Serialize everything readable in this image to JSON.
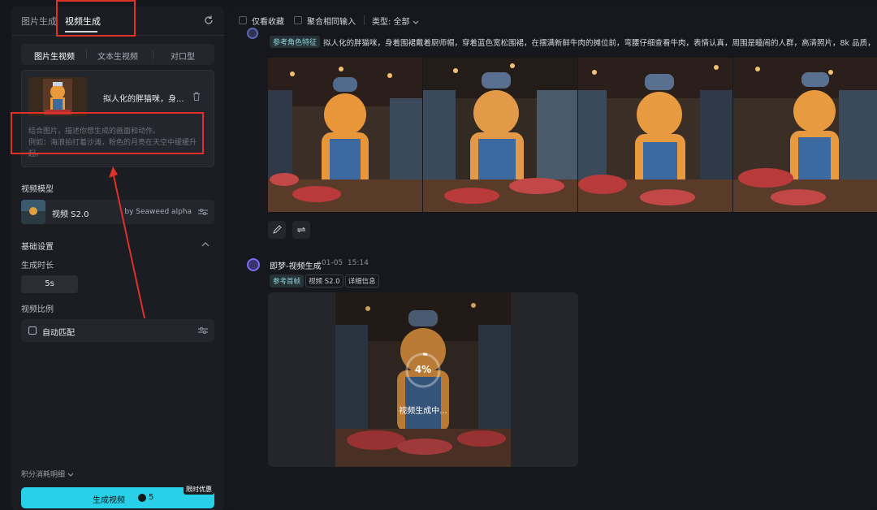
{
  "sidebar": {
    "tabs": [
      "图片生成",
      "视频生成"
    ],
    "mode_options": [
      "图片生视频",
      "文本生视频",
      "对口型"
    ],
    "upload_card": {
      "title": "拟人化的胖猫咪，身...",
      "hint_line1": "结合图片，描述你想生成的画面和动作。",
      "hint_line2": "例如：海浪拍打着沙滩，粉色的月亮在天空中缓缓升起。"
    },
    "model_section_label": "视频模型",
    "model": {
      "name": "视频 S2.0",
      "by": "by Seaweed alpha"
    },
    "basic_settings_label": "基础设置",
    "duration_label": "生成时长",
    "duration_value": "5s",
    "ratio_label": "视频比例",
    "ratio_value": "自动匹配",
    "points_label": "积分消耗明细",
    "generate": {
      "label": "生成视频",
      "cost": "5",
      "badge": "限时优惠"
    }
  },
  "filters": {
    "favorites_label": "仅看收藏",
    "group_label": "聚合相同输入",
    "type_label": "类型: 全部"
  },
  "image_job": {
    "tag": "参考角色特征",
    "prompt": "拟人化的胖猫咪，身着围裙戴着厨师帽，穿着蓝色宽松围裙，在摆满新鲜牛肉的摊位前，弯腰仔细查看牛肉，表情认真，周围是瞌闹的人群，高清照片，8k 品质，"
  },
  "video_job": {
    "title": "即梦-视频生成",
    "date": "01-05",
    "time": "15:14",
    "tags": [
      "参考首帧",
      "视频 S2.0",
      "详细信息"
    ],
    "progress_pct": "4%",
    "progress_text": "视频生成中..."
  },
  "colors": {
    "accent": "#28d0e8",
    "highlight": "#e0302a"
  }
}
